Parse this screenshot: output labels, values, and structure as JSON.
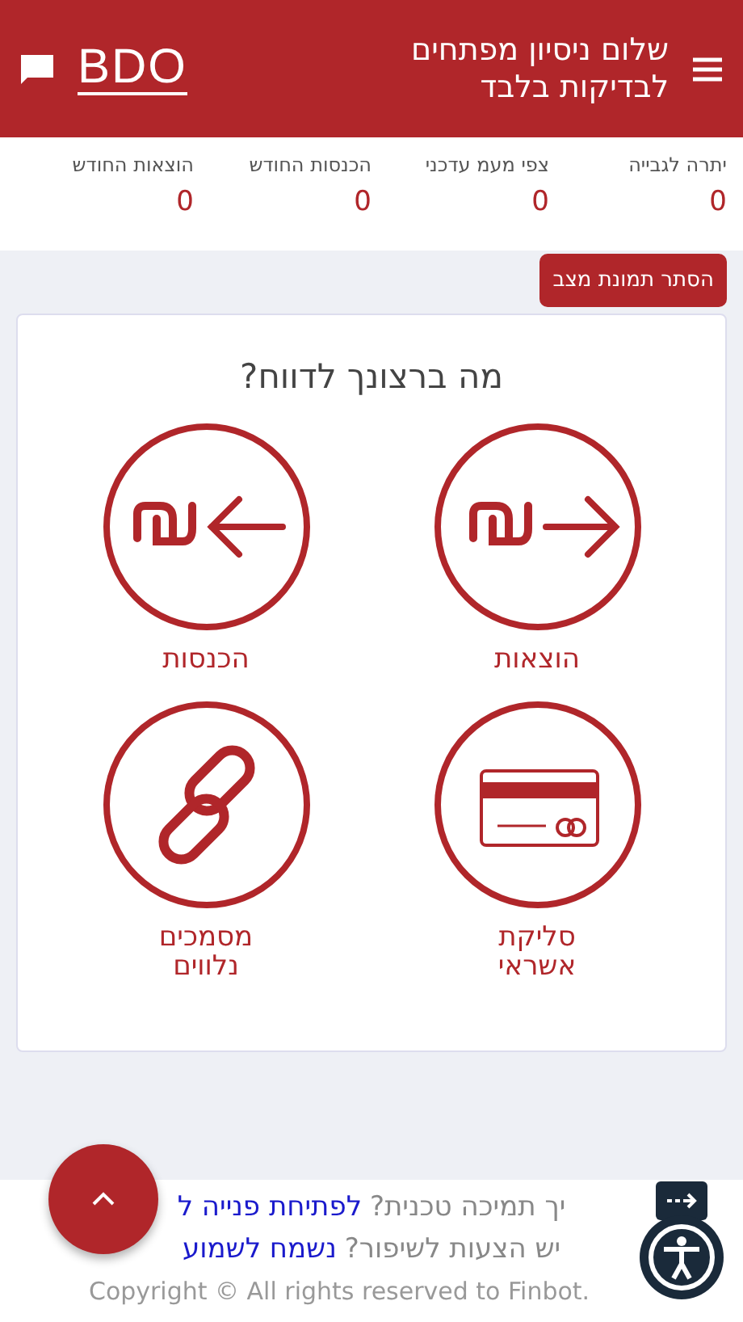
{
  "header": {
    "title": "שלום ניסיון מפתחים לבדיקות בלבד",
    "logo": "BDO"
  },
  "stats": [
    {
      "label": "יתרה לגבייה",
      "value": "0"
    },
    {
      "label": "צפי מעמ עדכני",
      "value": "0"
    },
    {
      "label": "הכנסות החודש",
      "value": "0"
    },
    {
      "label": "הוצאות החודש",
      "value": "0"
    }
  ],
  "hide_button": "הסתר תמונת מצב",
  "report": {
    "title": "מה ברצונך לדווח?",
    "options": [
      {
        "kind": "expense",
        "label": "הוצאות"
      },
      {
        "kind": "income",
        "label": "הכנסות"
      },
      {
        "kind": "card",
        "label": "סליקת אשראי"
      },
      {
        "kind": "link",
        "label": "מסמכים נלווים"
      }
    ]
  },
  "footer": {
    "support_text": "יך תמיכה טכנית?",
    "support_link": "לפתיחת פנייה ל",
    "ideas_text": "יש הצעות לשיפור?",
    "ideas_link": "נשמח לשמוע",
    "copyright": "Copyright © All rights reserved to Finbot."
  }
}
